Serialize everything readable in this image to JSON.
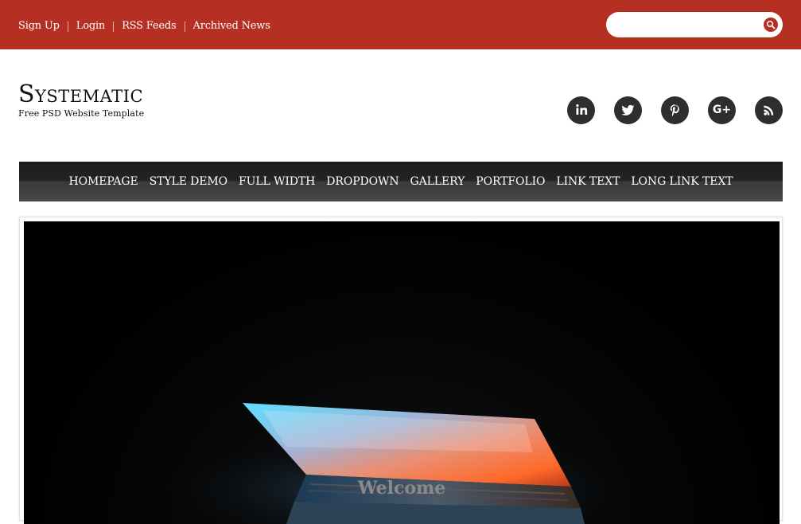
{
  "topbar": {
    "links": [
      "Sign Up",
      "Login",
      "RSS Feeds",
      "Archived News"
    ],
    "search": {
      "value": "",
      "placeholder": ""
    },
    "search_button_icon": "search-icon",
    "color": "#b52f23"
  },
  "header": {
    "logo_title": "Systematic",
    "tagline": "Free PSD Website Template",
    "social_icons": [
      "linkedin-icon",
      "twitter-icon",
      "pinterest-icon",
      "google-plus-icon",
      "rss-icon"
    ],
    "social_labels": {
      "google_plus": "G+"
    }
  },
  "nav": {
    "items": [
      "HOMEPAGE",
      "STYLE DEMO",
      "FULL WIDTH",
      "DROPDOWN",
      "GALLERY",
      "PORTFOLIO",
      "LINK TEXT",
      "LONG LINK TEXT"
    ]
  },
  "hero": {
    "caption": "Welcome",
    "image": "laptop-photo"
  }
}
